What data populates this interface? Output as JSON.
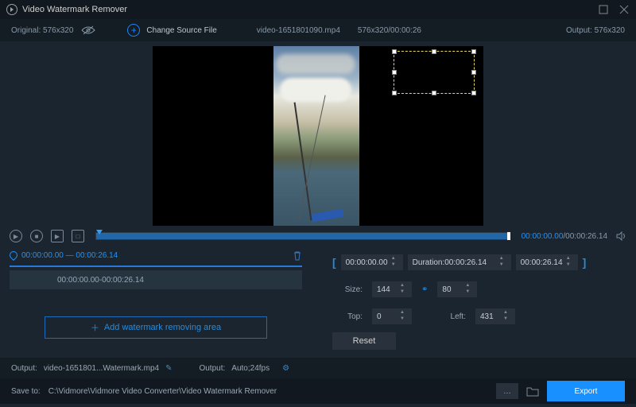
{
  "title": "Video Watermark Remover",
  "window": {
    "original_label": "Original:",
    "original_dims": "576x320",
    "output_label": "Output:",
    "output_dims": "576x320"
  },
  "source": {
    "change_label": "Change Source File",
    "filename": "video-1651801090.mp4",
    "dims_time": "576x320/00:00:26"
  },
  "playback": {
    "current": "00:00:00.00",
    "duration": "00:00:26.14"
  },
  "clips": {
    "active_start": "00:00:00.00",
    "active_end": "00:00:26.14",
    "row_label": "00:00:00.00-00:00:26.14",
    "add_label": "Add watermark removing area"
  },
  "range": {
    "start": "00:00:00.00",
    "duration_label": "Duration:",
    "duration": "00:00:26.14",
    "end": "00:00:26.14"
  },
  "size": {
    "label": "Size:",
    "w": "144",
    "h": "80"
  },
  "pos": {
    "top_label": "Top:",
    "top": "0",
    "left_label": "Left:",
    "left": "431"
  },
  "reset": "Reset",
  "footer": {
    "output_label1": "Output:",
    "output_file": "video-1651801...Watermark.mp4",
    "output_label2": "Output:",
    "output_fmt": "Auto;24fps",
    "save_label": "Save to:",
    "save_path": "C:\\Vidmore\\Vidmore Video Converter\\Video Watermark Remover",
    "export": "Export"
  }
}
